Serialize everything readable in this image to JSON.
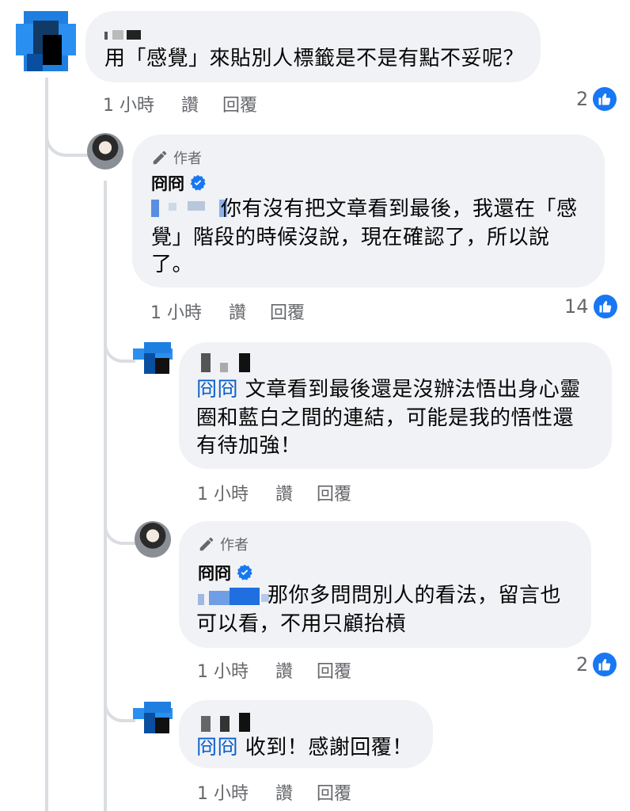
{
  "comments": [
    {
      "text": "用「感覺」來貼別人標籤是不是有點不妥呢？",
      "time": "1 小時",
      "like_label": "讚",
      "reply_label": "回覆",
      "reaction_count": "2"
    },
    {
      "author_badge": "作者",
      "author_name": "冏冏",
      "text_line1": "你有沒有把文章看到最後，我還在「感",
      "text_line2": "覺」階段的時候沒說，現在確認了，所以說",
      "text_line3": "了。",
      "time": "1 小時",
      "like_label": "讚",
      "reply_label": "回覆",
      "reaction_count": "14"
    },
    {
      "mention": "冏冏",
      "text_line1": " 文章看到最後還是沒辦法悟出身心靈",
      "text_line2": "圈和藍白之間的連結，可能是我的悟性還",
      "text_line3": "有待加強！",
      "time": "1 小時",
      "like_label": "讚",
      "reply_label": "回覆"
    },
    {
      "author_badge": "作者",
      "author_name": "冏冏",
      "text_line1": "那你多問問別人的看法，留言也",
      "text_line2": "可以看，不用只顧抬槓",
      "time": "1 小時",
      "like_label": "讚",
      "reply_label": "回覆",
      "reaction_count": "2"
    },
    {
      "mention": "冏冏",
      "text_line1": " 收到！感謝回覆！",
      "time": "1 小時",
      "like_label": "讚",
      "reply_label": "回覆"
    }
  ],
  "colors": {
    "bubble": "#f0f2f5",
    "like_blue": "#1877f2",
    "mention_blue": "#0b5fcc",
    "meta_gray": "#65676b",
    "verified_blue": "#1877f2"
  },
  "icons": [
    "like-icon",
    "pencil-icon",
    "verified-icon"
  ]
}
